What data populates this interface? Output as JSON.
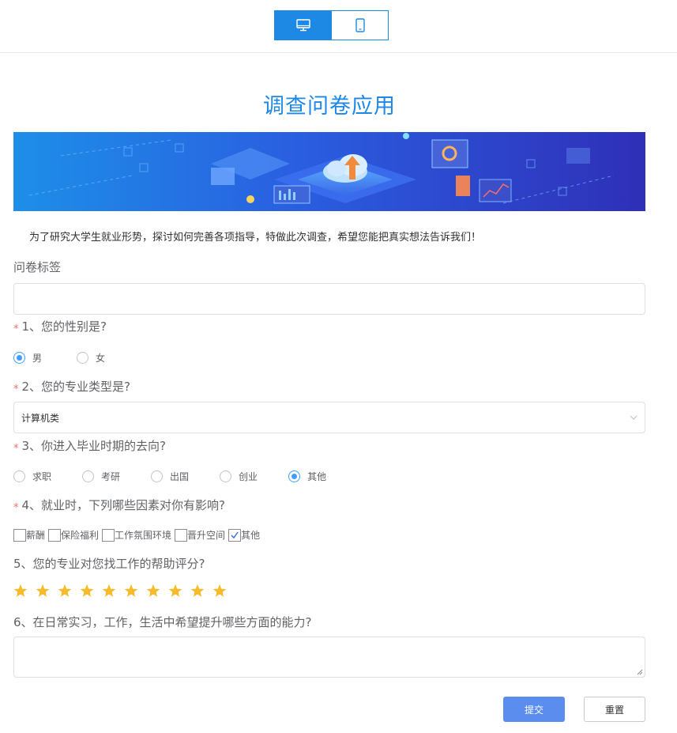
{
  "header": {
    "device_buttons": [
      {
        "icon": "desktop-icon",
        "active": true
      },
      {
        "icon": "mobile-icon",
        "active": false
      }
    ]
  },
  "title": "调查问卷应用",
  "intro": "为了研究大学生就业形势，探讨如何完善各项指导，特做此次调查，希望您能把真实想法告诉我们！",
  "tag_label": "问卷标签",
  "tag_value": "",
  "q1": {
    "label": "1、您的性别是?",
    "required": "*",
    "options": [
      "男",
      "女"
    ],
    "selected": "男"
  },
  "q2": {
    "label": "2、您的专业类型是?",
    "required": "*",
    "value": "计算机类"
  },
  "q3": {
    "label": "3、你进入毕业时期的去向?",
    "required": "*",
    "options": [
      "求职",
      "考研",
      "出国",
      "创业",
      "其他"
    ],
    "selected": "其他"
  },
  "q4": {
    "label": "4、就业时，下列哪些因素对你有影响?",
    "required": "*",
    "options": [
      "薪酬",
      "保险福利",
      "工作氛围环境",
      "晋升空间",
      "其他"
    ],
    "checked": [
      "其他"
    ]
  },
  "q5": {
    "label": "5、您的专业对您找工作的帮助评分?",
    "rating": 10,
    "max": 10,
    "star_color": "#f7ba2a"
  },
  "q6": {
    "label": "6、在日常实习，工作，生活中希望提升哪些方面的能力?",
    "value": ""
  },
  "buttons": {
    "submit": "提交",
    "reset": "重置"
  },
  "colors": {
    "primary": "#1e88e5",
    "radio_checked": "#409eff",
    "required": "#f56c6c",
    "submit_bg": "#5b8def"
  }
}
